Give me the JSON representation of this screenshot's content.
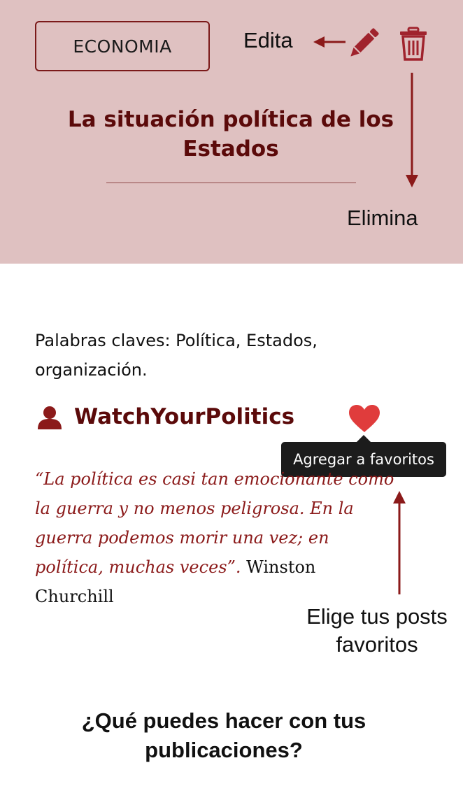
{
  "header": {
    "category_label": "ECONOMIA",
    "edit_label": "Edita",
    "delete_label": "Elimina",
    "title": "La situación política de los Estados",
    "background_color": "#dfc1c1",
    "accent_color": "#7b1a1a"
  },
  "icons": {
    "edit": "pencil-icon",
    "delete": "trash-icon",
    "user": "user-icon",
    "favorite": "heart-icon"
  },
  "post": {
    "keywords": "Palabras claves: Política, Estados, organización.",
    "author": "WatchYourPolitics",
    "favorite_tooltip": "Agregar a favoritos",
    "quote": "“La política es casi tan emocionante como la guerra y no menos peligrosa. En la guerra podemos morir una vez; en política, muchas veces”.",
    "quote_author": "Winston Churchill",
    "heart_color": "#e03c3c"
  },
  "annotations": {
    "favorites_label": "Elige tus posts favoritos",
    "help_heading": "¿Qué puedes hacer con tus publicaciones?"
  }
}
